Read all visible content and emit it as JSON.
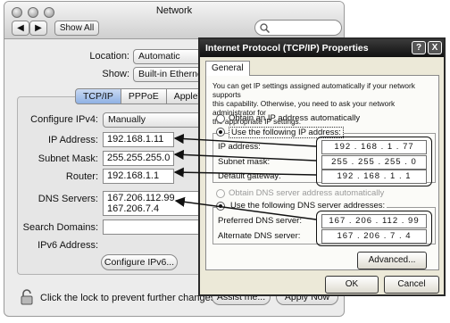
{
  "mac_window": {
    "title": "Network",
    "nav": {
      "back": "◀",
      "forward": "▶"
    },
    "show_all": "Show All",
    "search_placeholder": "",
    "location": {
      "label": "Location:",
      "value": "Automatic"
    },
    "show": {
      "label": "Show:",
      "value": "Built-in Ethernet"
    },
    "tabs": [
      {
        "label": "TCP/IP",
        "active": true
      },
      {
        "label": "PPPoE",
        "active": false
      },
      {
        "label": "AppleTalk",
        "active": false
      }
    ],
    "configure_ipv4": {
      "label": "Configure IPv4:",
      "value": "Manually"
    },
    "ip_address": {
      "label": "IP Address:",
      "value": "192.168.1.11"
    },
    "subnet_mask": {
      "label": "Subnet Mask:",
      "value": "255.255.255.0"
    },
    "router": {
      "label": "Router:",
      "value": "192.168.1.1"
    },
    "dns_servers": {
      "label": "DNS Servers:",
      "values": [
        "167.206.112.99",
        "167.206.7.4"
      ]
    },
    "search_domains": {
      "label": "Search Domains:",
      "value": ""
    },
    "ipv6_address": {
      "label": "IPv6 Address:"
    },
    "configure_ipv6_button": "Configure IPv6...",
    "lock_text": "Click the lock to prevent further changes.",
    "assist_button": "Assist me...",
    "apply_button": "Apply Now"
  },
  "win_dialog": {
    "title": "Internet Protocol (TCP/IP) Properties",
    "help_btn": "?",
    "close_btn": "X",
    "tab": "General",
    "intro_lines": [
      "You can get IP settings assigned automatically if your network supports",
      "this capability. Otherwise, you need to ask your network administrator for",
      "the appropriate IP settings."
    ],
    "obtain_ip_auto": "Obtain an IP address automatically",
    "use_following_ip": "Use the following IP address:",
    "ip_address": {
      "label": "IP address:",
      "octets": [
        "192",
        "168",
        "1",
        "77"
      ]
    },
    "subnet_mask": {
      "label": "Subnet mask:",
      "octets": [
        "255",
        "255",
        "255",
        "0"
      ]
    },
    "default_gateway": {
      "label": "Default gateway:",
      "octets": [
        "192",
        "168",
        "1",
        "1"
      ]
    },
    "obtain_dns_auto": "Obtain DNS server address automatically",
    "use_following_dns": "Use the following DNS server addresses:",
    "preferred_dns": {
      "label": "Preferred DNS server:",
      "octets": [
        "167",
        "206",
        "112",
        "99"
      ]
    },
    "alternate_dns": {
      "label": "Alternate DNS server:",
      "octets": [
        "167",
        "206",
        "7",
        "4"
      ]
    },
    "advanced_button": "Advanced...",
    "ok_button": "OK",
    "cancel_button": "Cancel"
  },
  "colors": {
    "mac_bg": "#ececec",
    "win_bg": "#ece9d8",
    "win_title": "#111111",
    "active_tab": "#8fb1e4"
  }
}
